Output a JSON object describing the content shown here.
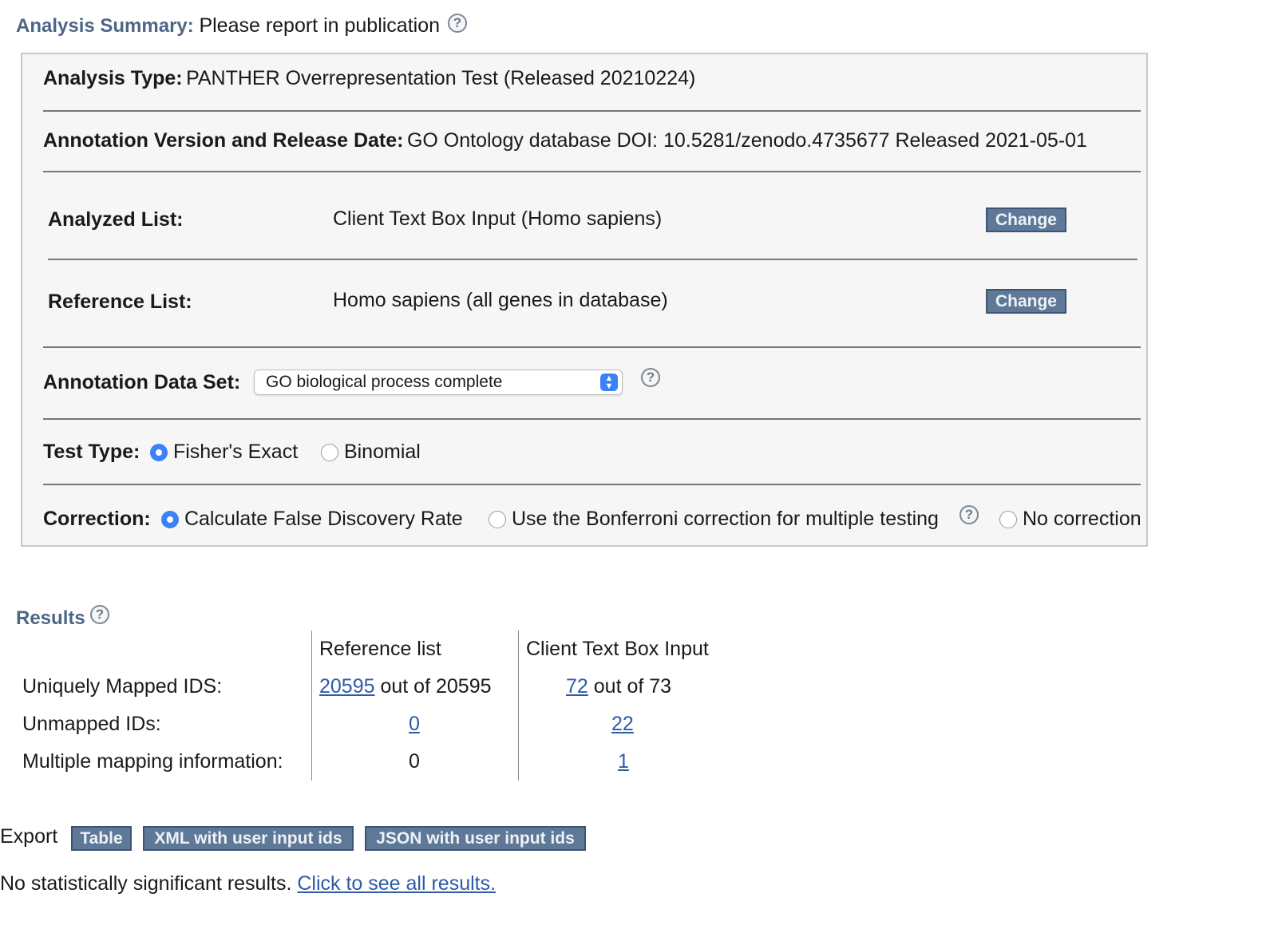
{
  "summary": {
    "heading": "Analysis Summary:",
    "heading_note": "Please report in publication",
    "help_icon": "?",
    "analysis_type_label": "Analysis Type:",
    "analysis_type_value": "PANTHER Overrepresentation Test (Released 20210224)",
    "annotation_version_label": "Annotation Version and Release Date:",
    "annotation_version_value": "GO Ontology database DOI: 10.5281/zenodo.4735677 Released 2021-05-01",
    "analyzed_list_label": "Analyzed List:",
    "analyzed_list_value": "Client Text Box Input (Homo sapiens)",
    "analyzed_change": "Change",
    "reference_list_label": "Reference List:",
    "reference_list_value": "Homo sapiens (all genes in database)",
    "reference_change": "Change",
    "annotation_dataset_label": "Annotation Data Set:",
    "annotation_dataset_selected": "GO biological process complete",
    "test_type_label": "Test Type:",
    "test_options": [
      "Fisher's Exact",
      "Binomial"
    ],
    "test_selected": "Fisher's Exact",
    "correction_label": "Correction:",
    "correction_options": [
      "Calculate False Discovery Rate",
      "Use the Bonferroni correction for multiple testing",
      "No correction"
    ],
    "correction_selected": "Calculate False Discovery Rate"
  },
  "results": {
    "heading": "Results",
    "columns": [
      "Reference list",
      "Client Text Box Input"
    ],
    "rows": [
      {
        "label": "Uniquely Mapped IDS:",
        "ref_link": "20595",
        "ref_suffix": "out of 20595",
        "client_link": "72",
        "client_suffix": "out of 73"
      },
      {
        "label": "Unmapped IDs:",
        "ref_link": "0",
        "client_link": "22"
      },
      {
        "label": "Multiple mapping information:",
        "ref_value": "0",
        "client_link": "1"
      }
    ]
  },
  "export": {
    "label": "Export",
    "buttons": [
      "Table",
      "XML with user input ids",
      "JSON with user input ids"
    ]
  },
  "footer": {
    "message": "No statistically significant results.",
    "link": "Click to see all results."
  },
  "colors": {
    "heading_blue": "#4d6686",
    "button_blue": "#5e7898",
    "link_blue": "#2f5aa8",
    "radio_selected": "#3b82f6"
  }
}
